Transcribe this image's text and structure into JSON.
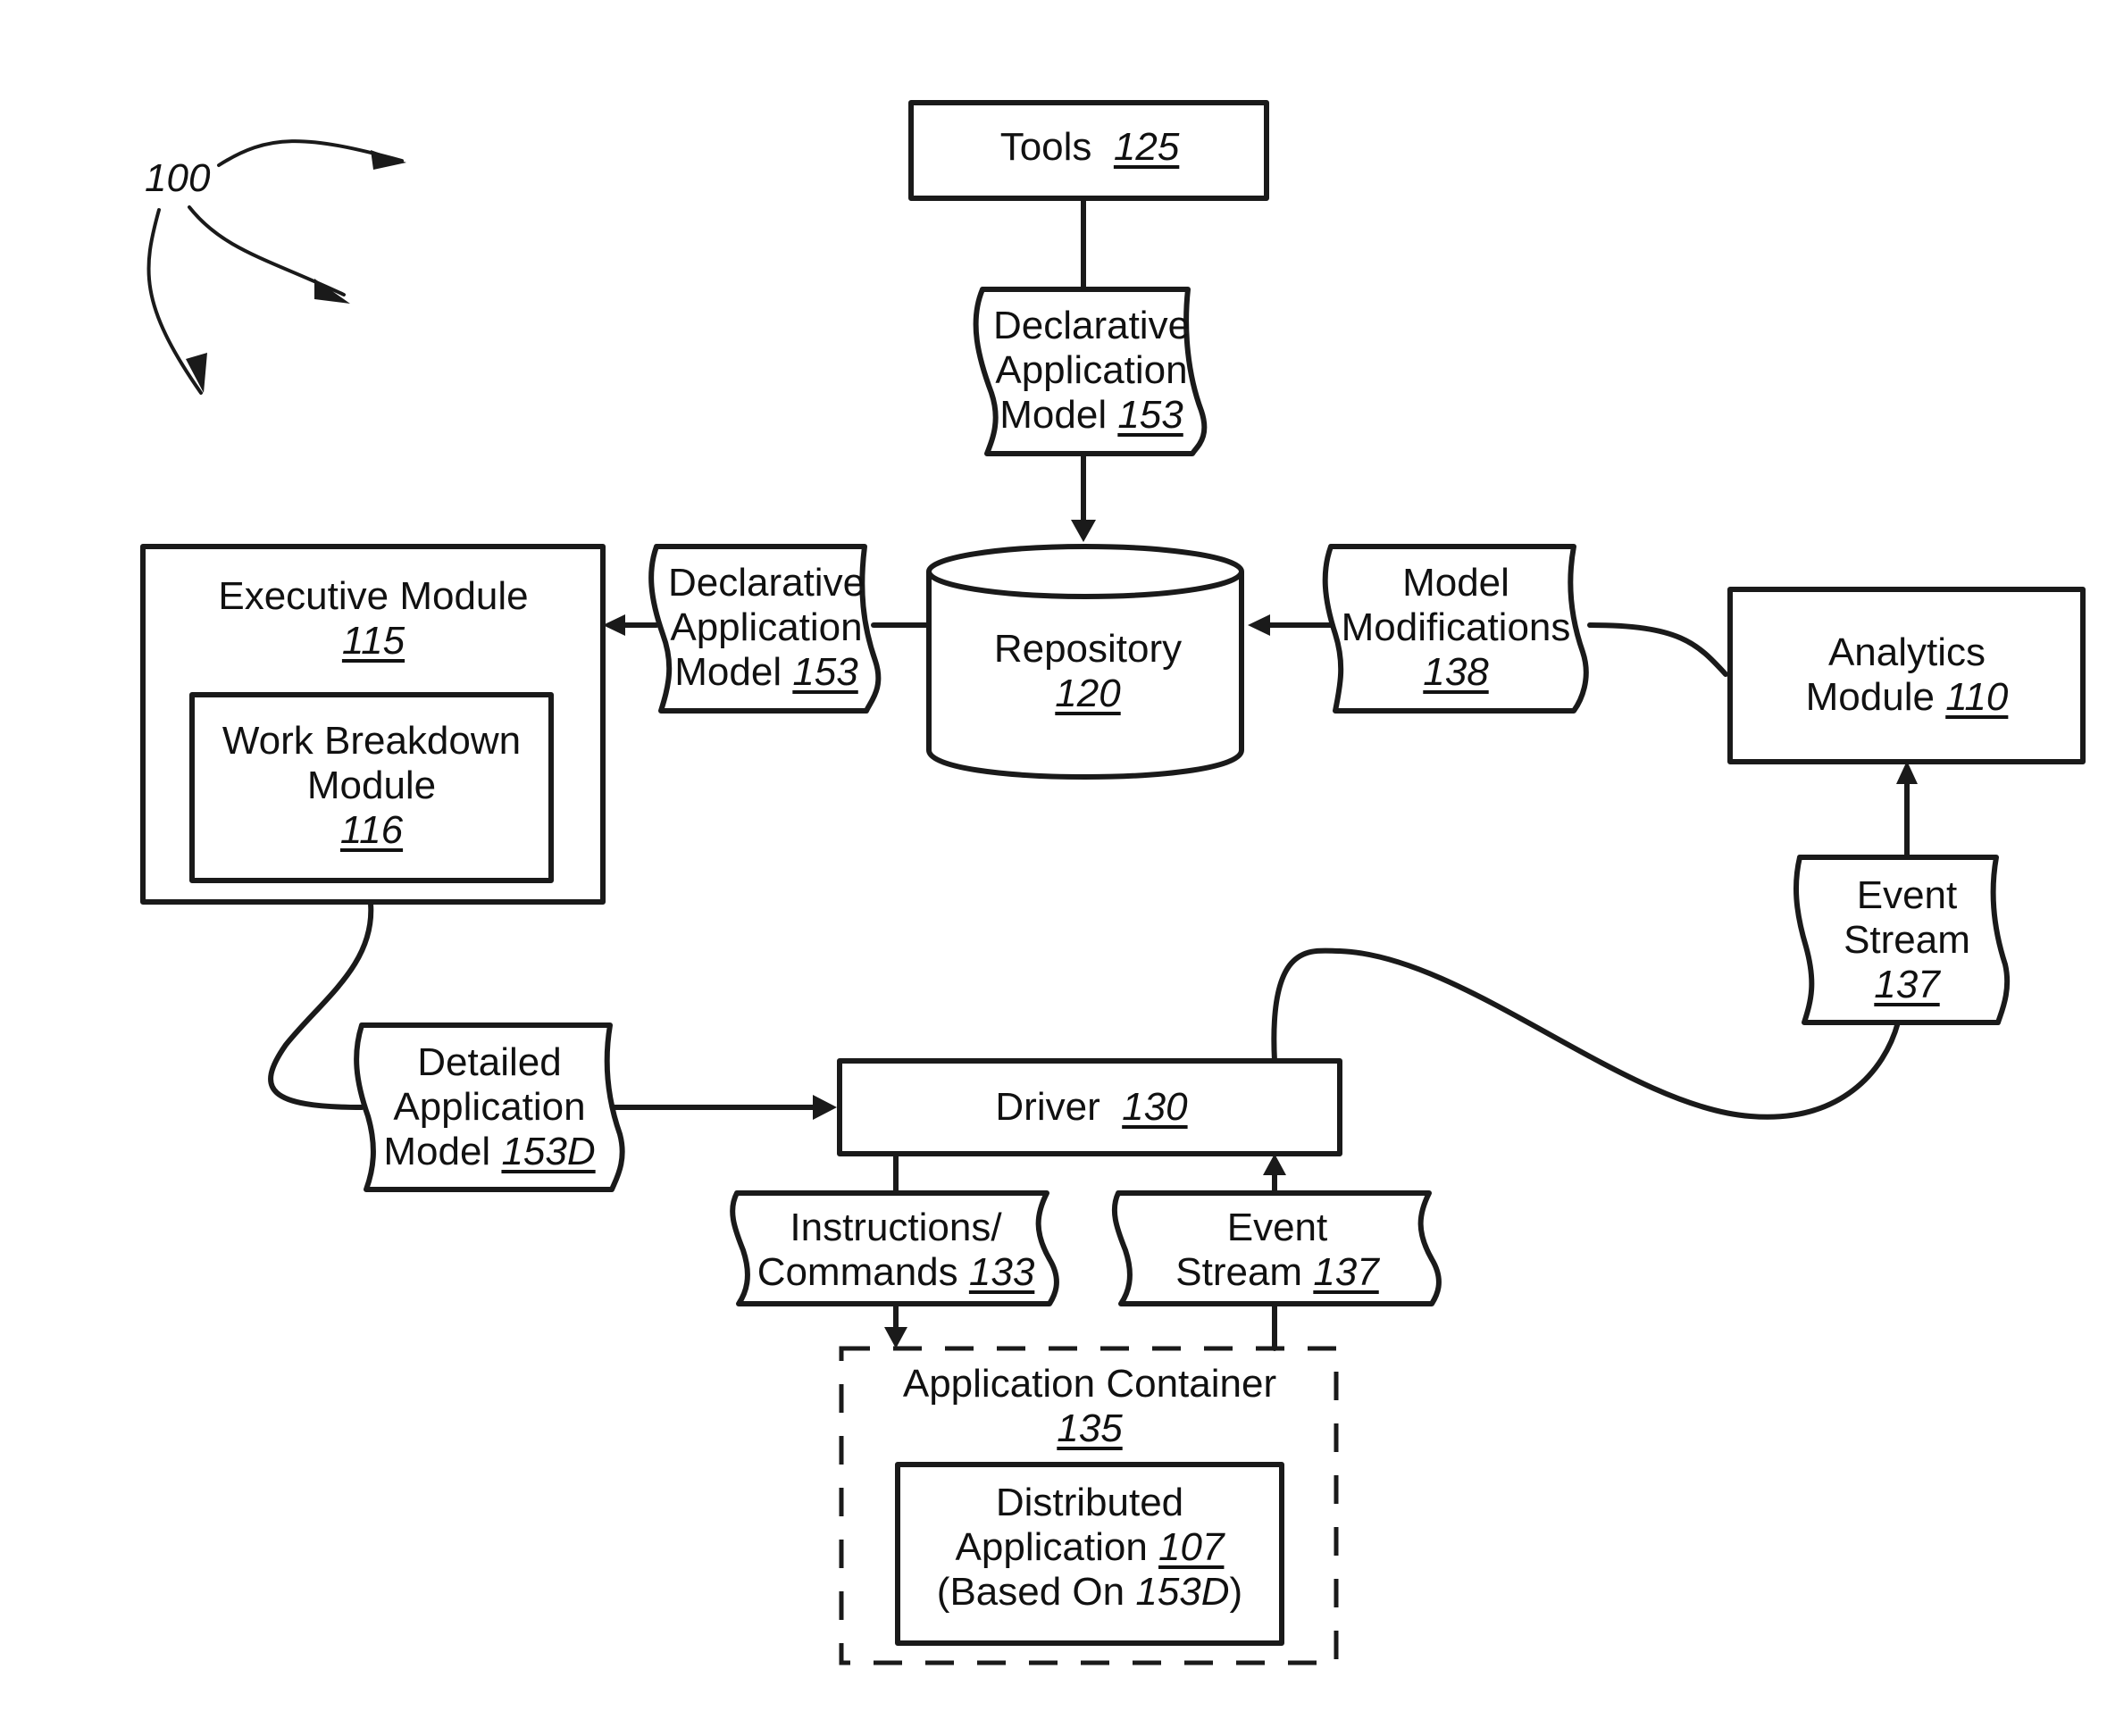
{
  "figure": {
    "ref": "100"
  },
  "nodes": {
    "tools": {
      "text": "Tools",
      "ref": "125"
    },
    "dam_top": {
      "line1": "Declarative",
      "line2": "Application",
      "line3": "Model",
      "ref": "153"
    },
    "repository": {
      "text": "Repository",
      "ref": "120"
    },
    "dam_left": {
      "line1": "Declarative",
      "line2": "Application",
      "line3": "Model",
      "ref": "153"
    },
    "executive": {
      "text": "Executive Module",
      "ref": "115"
    },
    "work_breakdown": {
      "line1": "Work Breakdown",
      "line2": "Module",
      "ref": "116"
    },
    "model_mods": {
      "line1": "Model",
      "line2": "Modifications",
      "ref": "138"
    },
    "analytics": {
      "line1": "Analytics",
      "line2": "Module",
      "ref": "110"
    },
    "event_stream_right": {
      "line1": "Event",
      "line2": "Stream",
      "ref": "137"
    },
    "detailed_model": {
      "line1": "Detailed",
      "line2": "Application",
      "line3": "Model",
      "ref": "153D"
    },
    "driver": {
      "text": "Driver",
      "ref": "130"
    },
    "instructions": {
      "line1": "Instructions/",
      "line2": "Commands",
      "ref": "133"
    },
    "event_stream_bottom": {
      "line1": "Event",
      "line2": "Stream",
      "ref": "137"
    },
    "app_container": {
      "text": "Application Container",
      "ref": "135"
    },
    "distributed_app": {
      "line1": "Distributed",
      "line2": "Application",
      "ref": "107",
      "line3_prefix": "(Based On ",
      "line3_ref": "153D",
      "line3_suffix": ")"
    }
  }
}
